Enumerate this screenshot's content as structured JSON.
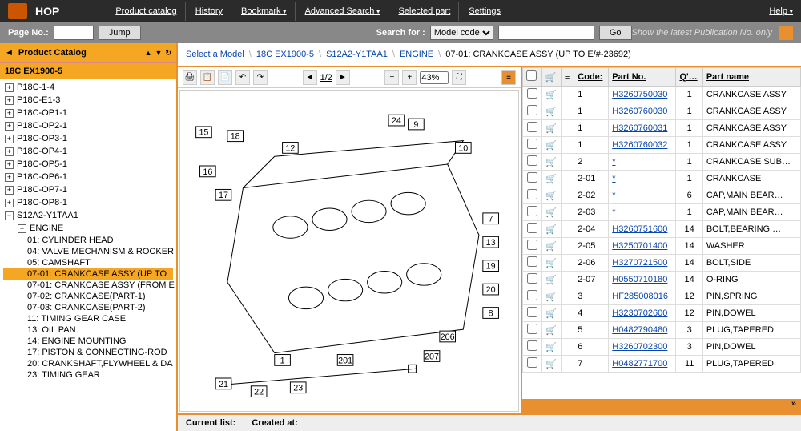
{
  "topbar": {
    "brand": "HOP",
    "menu": [
      "Product catalog",
      "History",
      "Bookmark",
      "Advanced Search",
      "Selected part",
      "Settings"
    ],
    "help": "Help"
  },
  "searchbar": {
    "pageLabel": "Page No.:",
    "jump": "Jump",
    "searchLabel": "Search for :",
    "searchMode": "Model code",
    "go": "Go",
    "pubNote": "Show the latest Publication No. only"
  },
  "sidebar": {
    "head": "Product Catalog",
    "title": "18C EX1900-5",
    "tree": [
      {
        "label": "P18C-1-4",
        "exp": "+"
      },
      {
        "label": "P18C-E1-3",
        "exp": "+"
      },
      {
        "label": "P18C-OP1-1",
        "exp": "+"
      },
      {
        "label": "P18C-OP2-1",
        "exp": "+"
      },
      {
        "label": "P18C-OP3-1",
        "exp": "+"
      },
      {
        "label": "P18C-OP4-1",
        "exp": "+"
      },
      {
        "label": "P18C-OP5-1",
        "exp": "+"
      },
      {
        "label": "P18C-OP6-1",
        "exp": "+"
      },
      {
        "label": "P18C-OP7-1",
        "exp": "+"
      },
      {
        "label": "P18C-OP8-1",
        "exp": "+"
      },
      {
        "label": "S12A2-Y1TAA1",
        "exp": "−"
      }
    ],
    "engineLabel": "ENGINE",
    "engineItems": [
      "01: CYLINDER HEAD",
      "04: VALVE MECHANISM & ROCKER",
      "05: CAMSHAFT",
      "07-01: CRANKCASE ASSY (UP TO",
      "07-01: CRANKCASE ASSY (FROM E",
      "07-02: CRANKCASE(PART-1)",
      "07-03: CRANKCASE(PART-2)",
      "11: TIMING GEAR CASE",
      "13: OIL PAN",
      "14: ENGINE MOUNTING",
      "17: PISTON & CONNECTING-ROD",
      "20: CRANKSHAFT,FLYWHEEL & DA",
      "23: TIMING GEAR"
    ],
    "selectedIndex": 3
  },
  "breadcrumb": {
    "select": "Select a Model",
    "items": [
      "18C EX1900-5",
      "S12A2-Y1TAA1",
      "ENGINE"
    ],
    "current": "07-01: CRANKCASE ASSY (UP TO E/#-23692)"
  },
  "diagram": {
    "page": "1/2",
    "zoom": "43%",
    "callouts": [
      "15",
      "16",
      "17",
      "18",
      "12",
      "9",
      "10",
      "24",
      "7",
      "13",
      "19",
      "20",
      "8",
      "1",
      "201",
      "207",
      "206",
      "21",
      "22",
      "23"
    ]
  },
  "table": {
    "headers": {
      "check": "",
      "cart": "",
      "info": "",
      "code": "Code:",
      "partno": "Part No.",
      "qty": "Q'…",
      "name": "Part name"
    },
    "rows": [
      {
        "code": "1",
        "partno": "H3260750030",
        "qty": "1",
        "name": "CRANKCASE ASSY"
      },
      {
        "code": "1",
        "partno": "H3260760030",
        "qty": "1",
        "name": "CRANKCASE ASSY"
      },
      {
        "code": "1",
        "partno": "H3260760031",
        "qty": "1",
        "name": "CRANKCASE ASSY"
      },
      {
        "code": "1",
        "partno": "H3260760032",
        "qty": "1",
        "name": "CRANKCASE ASSY"
      },
      {
        "code": "2",
        "partno": "*",
        "qty": "1",
        "name": "CRANKCASE SUB…"
      },
      {
        "code": "2-01",
        "partno": "*",
        "qty": "1",
        "name": "CRANKCASE"
      },
      {
        "code": "2-02",
        "partno": "*",
        "qty": "6",
        "name": "CAP,MAIN BEAR…"
      },
      {
        "code": "2-03",
        "partno": "*",
        "qty": "1",
        "name": "CAP,MAIN BEAR…"
      },
      {
        "code": "2-04",
        "partno": "H3260751600",
        "qty": "14",
        "name": "BOLT,BEARING …"
      },
      {
        "code": "2-05",
        "partno": "H3250701400",
        "qty": "14",
        "name": "WASHER"
      },
      {
        "code": "2-06",
        "partno": "H3270721500",
        "qty": "14",
        "name": "BOLT,SIDE"
      },
      {
        "code": "2-07",
        "partno": "H0550710180",
        "qty": "14",
        "name": "O-RING"
      },
      {
        "code": "3",
        "partno": "HF285008016",
        "qty": "12",
        "name": "PIN,SPRING"
      },
      {
        "code": "4",
        "partno": "H3230702600",
        "qty": "12",
        "name": "PIN,DOWEL"
      },
      {
        "code": "5",
        "partno": "H0482790480",
        "qty": "3",
        "name": "PLUG,TAPERED"
      },
      {
        "code": "6",
        "partno": "H3260702300",
        "qty": "3",
        "name": "PIN,DOWEL"
      },
      {
        "code": "7",
        "partno": "H0482771700",
        "qty": "11",
        "name": "PLUG,TAPERED"
      }
    ]
  },
  "status": {
    "currentList": "Current list:",
    "createdAt": "Created at:"
  }
}
